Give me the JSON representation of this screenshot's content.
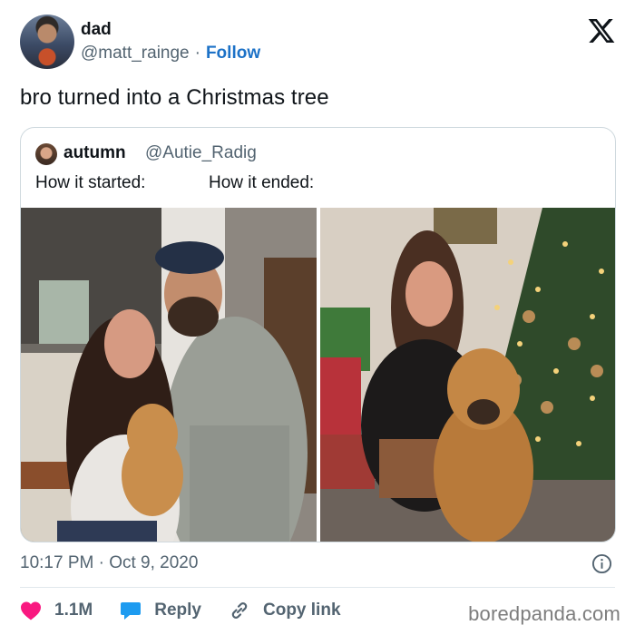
{
  "author": {
    "display_name": "dad",
    "handle": "@matt_rainge",
    "separator": "·",
    "follow_label": "Follow"
  },
  "tweet": {
    "text": "bro turned into a Christmas tree"
  },
  "quoted": {
    "display_name": "autumn",
    "handle": "@Autie_Radig",
    "text_left": "How it started:",
    "text_right": "How it ended:"
  },
  "meta": {
    "timestamp": "10:17 PM · Oct 9, 2020"
  },
  "actions": {
    "likes": "1.1M",
    "reply_label": "Reply",
    "copy_label": "Copy link"
  },
  "watermark": "boredpanda.com",
  "colors": {
    "accent": "#1d72c7",
    "heart": "#f91880",
    "reply": "#1d9bf0",
    "muted": "#536471"
  },
  "icons": {
    "brand": "x-logo-icon",
    "info": "info-icon",
    "like": "heart-icon",
    "reply": "speech-bubble-icon",
    "copy": "link-icon"
  }
}
